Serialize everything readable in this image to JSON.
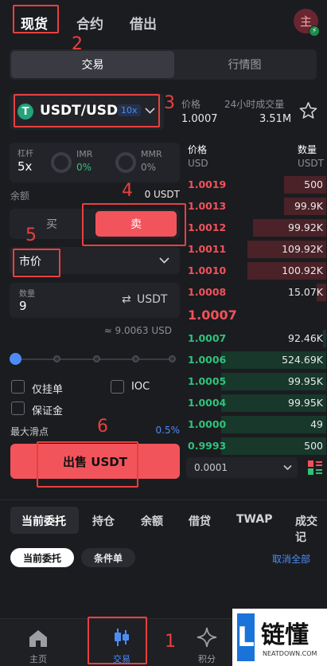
{
  "top_tabs": [
    "现货",
    "合约",
    "借出"
  ],
  "avatar": {
    "label": "主",
    "badge": "⚡"
  },
  "segment": {
    "trade": "交易",
    "market": "行情图"
  },
  "pair": {
    "name": "USDT/USD",
    "leverage": "10x",
    "icon": "T"
  },
  "ticker": {
    "price_label": "价格",
    "price": "1.0007",
    "volume_label": "24小时成交量",
    "volume": "3.51M"
  },
  "leverage_card": {
    "label": "杠杆",
    "value": "5x",
    "imr_label": "IMR",
    "imr": "0%",
    "mmr_label": "MMR",
    "mmr": "0%"
  },
  "balance": {
    "label": "余额",
    "value": "0 USDT"
  },
  "side": {
    "buy": "买",
    "sell": "卖"
  },
  "order_type": {
    "value": "市价"
  },
  "quantity": {
    "label": "数量",
    "value": "9",
    "unit": "USDT"
  },
  "estimate": "≈ 9.0063 USD",
  "slider": {
    "value": 0
  },
  "options": {
    "post_only": "仅挂单",
    "ioc": "IOC",
    "margin": "保证金"
  },
  "slippage": {
    "label": "最大滑点",
    "value": "0.5%"
  },
  "submit": "出售 USDT",
  "orderbook": {
    "price_header": "价格",
    "price_unit": "USD",
    "qty_header": "数量",
    "qty_unit": "USDT",
    "asks": [
      {
        "p": "1.0019",
        "q": "500",
        "d": 0.3
      },
      {
        "p": "1.0013",
        "q": "99.9K",
        "d": 0.3
      },
      {
        "p": "1.0012",
        "q": "99.92K",
        "d": 0.52
      },
      {
        "p": "1.0011",
        "q": "109.92K",
        "d": 0.56
      },
      {
        "p": "1.0010",
        "q": "100.92K",
        "d": 0.56
      },
      {
        "p": "1.0008",
        "q": "15.07K",
        "d": 0.07
      }
    ],
    "mid": "1.0007",
    "bids": [
      {
        "p": "1.0007",
        "q": "92.46K",
        "d": 0.02
      },
      {
        "p": "1.0006",
        "q": "524.69K",
        "d": 0.75
      },
      {
        "p": "1.0005",
        "q": "99.95K",
        "d": 0.75
      },
      {
        "p": "1.0004",
        "q": "99.95K",
        "d": 0.75
      },
      {
        "p": "1.0000",
        "q": "49",
        "d": 0.75
      },
      {
        "p": "0.9993",
        "q": "500",
        "d": 0.75
      }
    ],
    "tick_size": "0.0001"
  },
  "bottom_tabs": [
    "当前委托",
    "持仓",
    "余额",
    "借贷",
    "TWAP",
    "成交记"
  ],
  "filters": {
    "current": "当前委托",
    "conditional": "条件单",
    "cancel_all": "取消全部"
  },
  "nav": [
    "主页",
    "交易",
    "积分"
  ],
  "annotations": [
    "1",
    "2",
    "3",
    "4",
    "5",
    "6"
  ],
  "watermark": {
    "main": "链懂",
    "sub": "NEATDOWN.COM",
    "logo": "L"
  }
}
